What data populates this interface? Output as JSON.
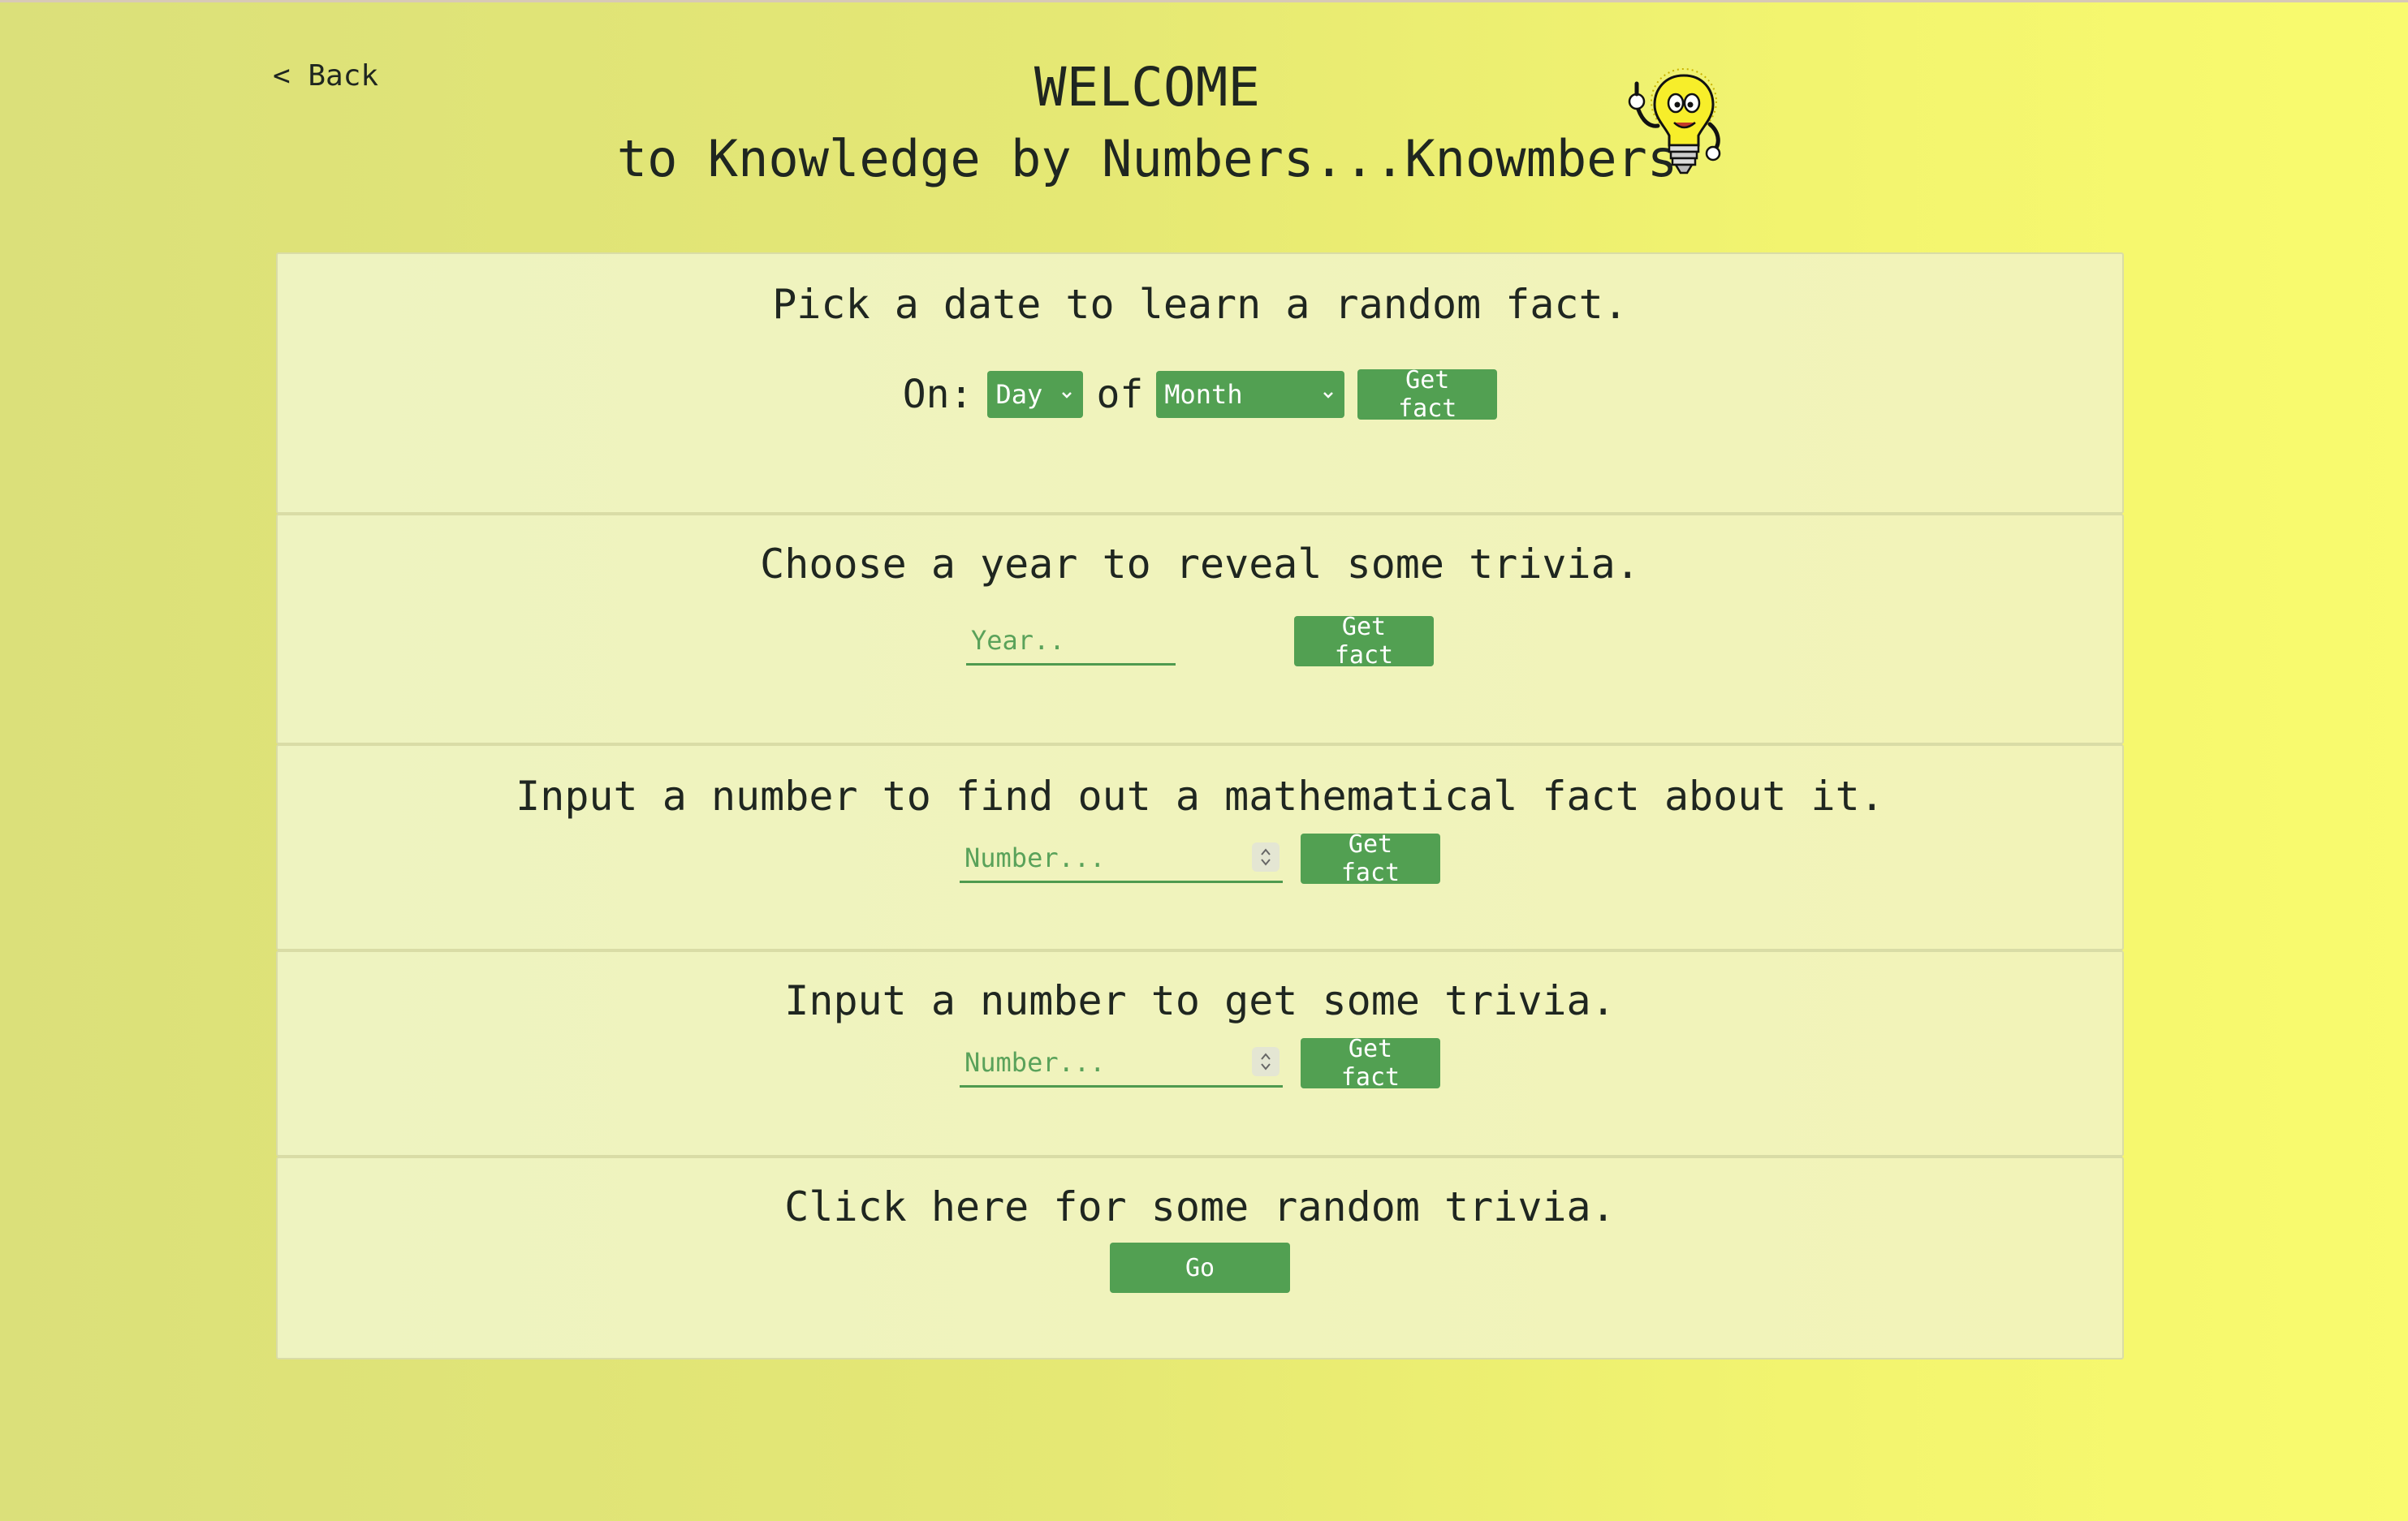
{
  "header": {
    "back_label": "< Back",
    "title": "WELCOME",
    "subtitle": "to Knowledge by Numbers...Knowmbers",
    "mascot_icon": "lightbulb-mascot-icon"
  },
  "date_section": {
    "title": "Pick a date to learn a random fact.",
    "on_label": "On:",
    "day_value": "Day",
    "of_label": "of",
    "month_value": "Month",
    "button": "Get fact"
  },
  "year_section": {
    "title": "Choose a year to reveal some trivia.",
    "placeholder": "Year..",
    "button": "Get fact"
  },
  "math_section": {
    "title": "Input a number to find out a mathematical fact about it.",
    "placeholder": "Number...",
    "button": "Get fact"
  },
  "trivia_section": {
    "title": "Input a number to get some trivia.",
    "placeholder": "Number...",
    "button": "Get fact"
  },
  "random_section": {
    "title": "Click here for some random trivia.",
    "button": "Go"
  },
  "colors": {
    "accent_green": "#52a052",
    "background_yellow": "#f9fb6e",
    "panel": "#eef3c0"
  }
}
